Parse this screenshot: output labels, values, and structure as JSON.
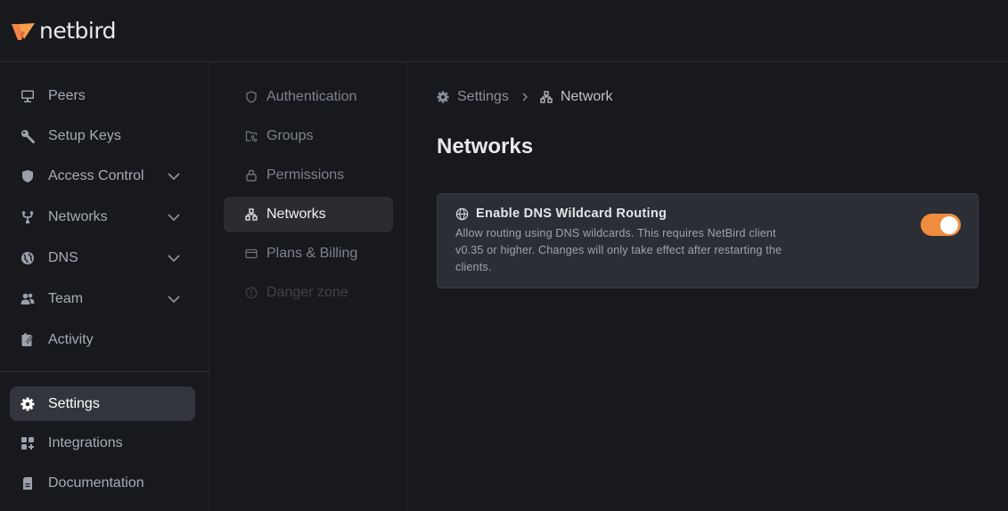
{
  "app": {
    "brand": "netbird",
    "accent_color": "#f08c3d"
  },
  "sidebar": {
    "items": [
      {
        "label": "Peers",
        "icon": "monitor-icon",
        "expandable": false,
        "active": false
      },
      {
        "label": "Setup Keys",
        "icon": "key-icon",
        "expandable": false,
        "active": false
      },
      {
        "label": "Access Control",
        "icon": "shield-icon",
        "expandable": true,
        "active": false
      },
      {
        "label": "Networks",
        "icon": "network-fork-icon",
        "expandable": true,
        "active": false
      },
      {
        "label": "DNS",
        "icon": "globe-icon",
        "expandable": true,
        "active": false
      },
      {
        "label": "Team",
        "icon": "users-icon",
        "expandable": true,
        "active": false
      },
      {
        "label": "Activity",
        "icon": "activity-log-icon",
        "expandable": false,
        "active": false
      }
    ],
    "bottom_items": [
      {
        "label": "Settings",
        "icon": "gear-icon",
        "active": true
      },
      {
        "label": "Integrations",
        "icon": "integrations-icon",
        "active": false
      },
      {
        "label": "Documentation",
        "icon": "document-icon",
        "active": false
      }
    ]
  },
  "settings_nav": {
    "items": [
      {
        "label": "Authentication",
        "icon": "shield-outline-icon",
        "state": "normal"
      },
      {
        "label": "Groups",
        "icon": "folder-groups-icon",
        "state": "normal"
      },
      {
        "label": "Permissions",
        "icon": "lock-icon",
        "state": "normal"
      },
      {
        "label": "Networks",
        "icon": "network-icon",
        "state": "active"
      },
      {
        "label": "Plans & Billing",
        "icon": "credit-card-icon",
        "state": "normal"
      },
      {
        "label": "Danger zone",
        "icon": "alert-circle-icon",
        "state": "disabled"
      }
    ]
  },
  "main": {
    "breadcrumb": [
      {
        "label": "Settings",
        "icon": "gear-icon"
      },
      {
        "label": "Network",
        "icon": "network-icon"
      }
    ],
    "title": "Networks",
    "settings": [
      {
        "title": "Enable DNS Wildcard Routing",
        "icon": "globe-icon",
        "description": "Allow routing using DNS wildcards. This requires NetBird client v0.35 or higher. Changes will only take effect after restarting the clients.",
        "enabled": true
      }
    ]
  }
}
